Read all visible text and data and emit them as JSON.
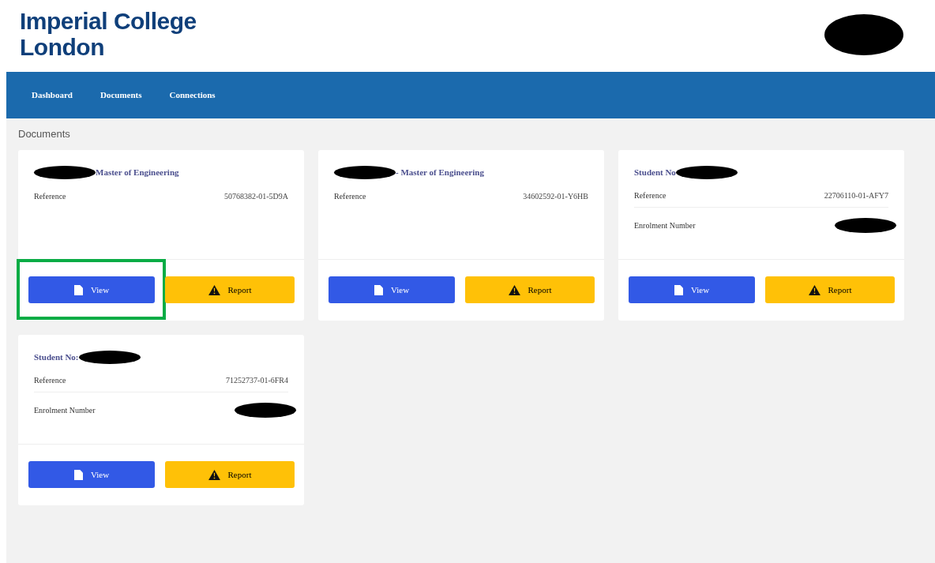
{
  "logo": {
    "lines": [
      "Imperial College",
      "London"
    ]
  },
  "user": {
    "redacted": true
  },
  "nav": [
    {
      "label": "Dashboard"
    },
    {
      "label": "Documents"
    },
    {
      "label": "Connections"
    }
  ],
  "page_title": "Documents",
  "cards": [
    {
      "heading": [
        {
          "kind": "redacted"
        },
        {
          "kind": "text",
          "text": "Master of Engineering"
        }
      ],
      "rows": [
        {
          "label": "Reference",
          "kind": "text",
          "value": "50768382-01-5D9A"
        }
      ],
      "buttons": [
        {
          "kind": "view",
          "label": "View",
          "highlighted": true
        },
        {
          "kind": "report",
          "label": "Report",
          "highlighted": false
        }
      ]
    },
    {
      "heading": [
        {
          "kind": "redacted"
        },
        {
          "kind": "text",
          "text": "- Master of Engineering"
        }
      ],
      "rows": [
        {
          "label": "Reference",
          "kind": "text",
          "value": "34602592-01-Y6HB"
        }
      ],
      "buttons": [
        {
          "kind": "view",
          "label": "View",
          "highlighted": false
        },
        {
          "kind": "report",
          "label": "Report",
          "highlighted": false
        }
      ]
    },
    {
      "heading": [
        {
          "kind": "text",
          "text": "Student No"
        },
        {
          "kind": "redacted"
        }
      ],
      "rows": [
        {
          "label": "Reference",
          "kind": "text",
          "value": "22706110-01-AFY7"
        },
        {
          "label": "Enrolment Number",
          "kind": "redacted"
        }
      ],
      "buttons": [
        {
          "kind": "view",
          "label": "View",
          "highlighted": false
        },
        {
          "kind": "report",
          "label": "Report",
          "highlighted": false
        }
      ]
    },
    {
      "heading": [
        {
          "kind": "text",
          "text": "Student No:"
        },
        {
          "kind": "redacted"
        }
      ],
      "rows": [
        {
          "label": "Reference",
          "kind": "text",
          "value": "71252737-01-6FR4"
        },
        {
          "label": "Enrolment Number",
          "kind": "redacted"
        }
      ],
      "buttons": [
        {
          "kind": "view",
          "label": "View",
          "highlighted": false
        },
        {
          "kind": "report",
          "label": "Report",
          "highlighted": false
        }
      ]
    }
  ]
}
